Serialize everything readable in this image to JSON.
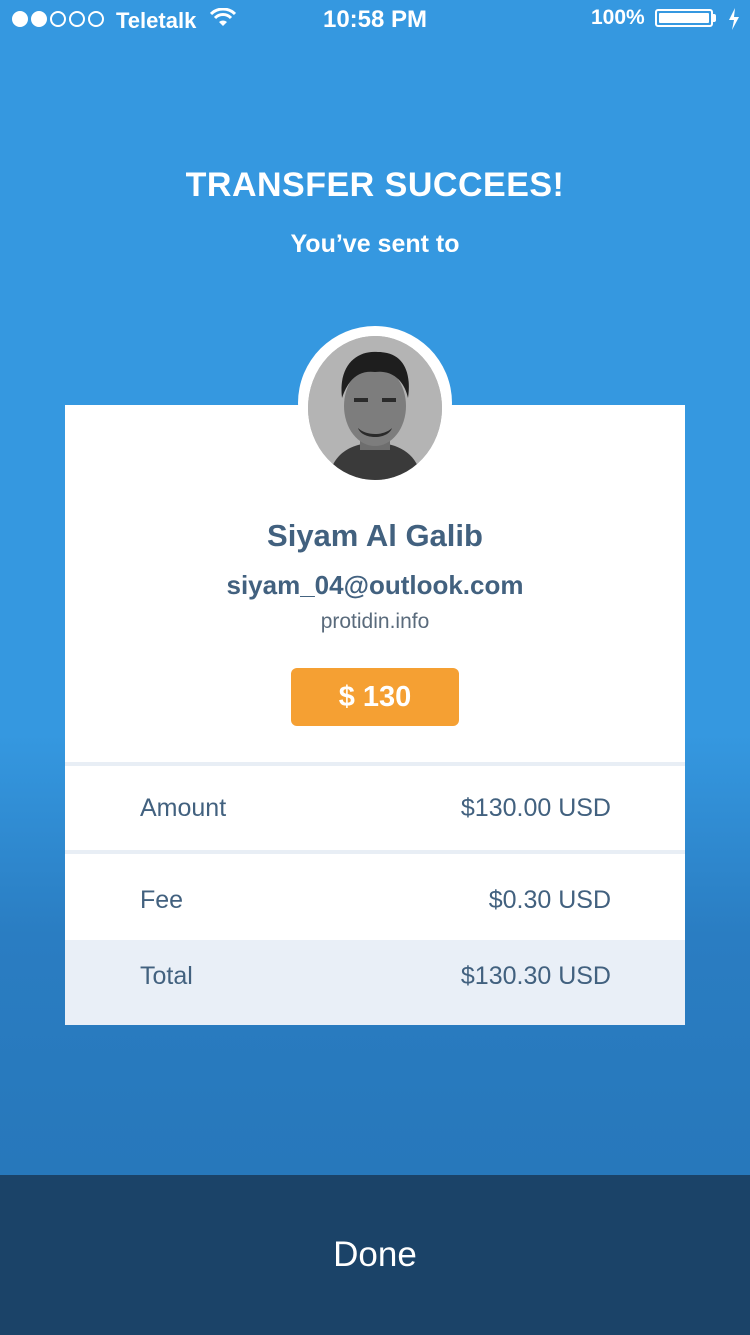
{
  "status_bar": {
    "carrier": "Teletalk",
    "time": "10:58 PM",
    "battery": "100%",
    "signal_dots": [
      true,
      true,
      false,
      false,
      false
    ]
  },
  "header": {
    "title": "TRANSFER SUCCEES!",
    "subtitle": "You’ve sent to"
  },
  "recipient": {
    "name": "Siyam Al Galib",
    "email": "siyam_04@outlook.com",
    "domain": "protidin.info",
    "amount_badge": "$ 130"
  },
  "summary": {
    "rows": [
      {
        "label": "Amount",
        "value": "$130.00 USD"
      },
      {
        "label": "Fee",
        "value": "$0.30 USD"
      },
      {
        "label": "Total",
        "value": "$130.30 USD"
      }
    ]
  },
  "footer": {
    "done_label": "Done"
  },
  "colors": {
    "accent": "#3598e0",
    "badge": "#f5a033",
    "footer": "#1b4368",
    "text": "#42617f"
  }
}
